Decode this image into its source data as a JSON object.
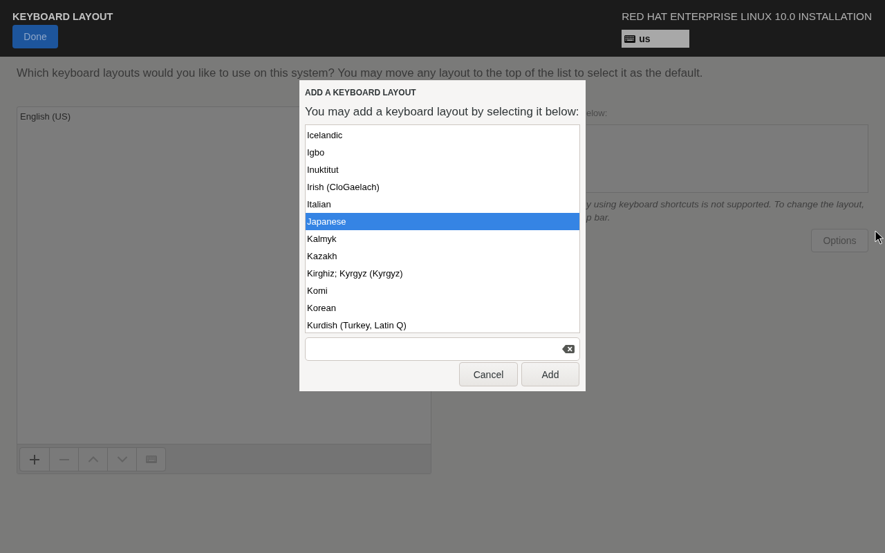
{
  "header": {
    "title": "KEYBOARD LAYOUT",
    "done_button": "Done",
    "product": "RED HAT ENTERPRISE LINUX 10.0 INSTALLATION",
    "layout_indicator": "us"
  },
  "instructions": "Which keyboard layouts would you like to use on this system?  You may move any layout to the top of the list to select it as the default.",
  "layouts_panel": {
    "items": [
      {
        "label": "English (US)",
        "selected": false
      }
    ],
    "toolbar": [
      {
        "kind": "add",
        "disabled": false
      },
      {
        "kind": "remove",
        "disabled": true
      },
      {
        "kind": "up",
        "disabled": true
      },
      {
        "kind": "down",
        "disabled": true
      },
      {
        "kind": "preview",
        "disabled": true
      }
    ]
  },
  "switching_panel": {
    "label": "elow:",
    "note_lines": [
      "y using keyboard shortcuts is not supported. To change the layout,",
      "p bar."
    ],
    "options_button": "Options"
  },
  "dialog": {
    "title": "ADD A KEYBOARD LAYOUT",
    "prompt": "You may add a keyboard layout by selecting it below:",
    "layouts": [
      {
        "label": "Icelandic",
        "selected": false
      },
      {
        "label": "Igbo",
        "selected": false
      },
      {
        "label": "Inuktitut",
        "selected": false
      },
      {
        "label": "Irish (CloGaelach)",
        "selected": false
      },
      {
        "label": "Italian",
        "selected": false
      },
      {
        "label": "Japanese",
        "selected": true
      },
      {
        "label": "Kalmyk",
        "selected": false
      },
      {
        "label": "Kazakh",
        "selected": false
      },
      {
        "label": "Kirghiz; Kyrgyz (Kyrgyz)",
        "selected": false
      },
      {
        "label": "Komi",
        "selected": false
      },
      {
        "label": "Korean",
        "selected": false
      },
      {
        "label": "Kurdish (Turkey, Latin Q)",
        "selected": false
      }
    ],
    "buttons": [
      {
        "kind": "cancel",
        "label": "Cancel"
      },
      {
        "kind": "add",
        "label": "Add"
      }
    ]
  }
}
